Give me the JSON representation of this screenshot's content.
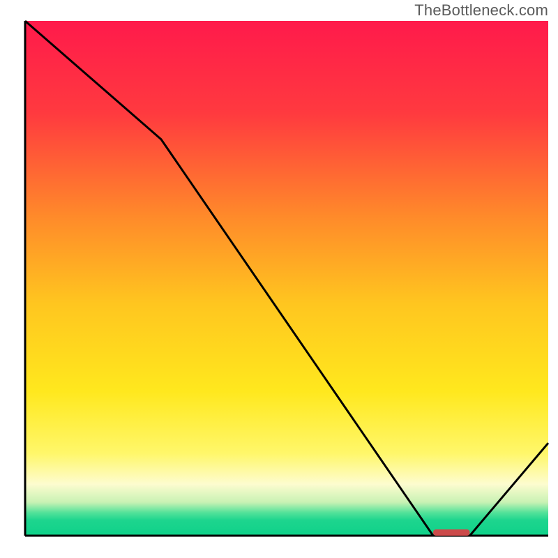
{
  "attribution": "TheBottleneck.com",
  "chart_data": {
    "type": "line",
    "title": "",
    "xlabel": "",
    "ylabel": "",
    "x_range": [
      0,
      100
    ],
    "y_range": [
      0,
      100
    ],
    "curve": {
      "x": [
        0,
        26,
        78,
        85,
        100
      ],
      "y": [
        100,
        77,
        0,
        0,
        18
      ]
    },
    "optimal_band": {
      "x_start": 78,
      "x_end": 85,
      "y": 0
    },
    "gradient_stops": [
      {
        "pos": 0.0,
        "color": "#ff1a4b"
      },
      {
        "pos": 0.18,
        "color": "#ff3a3f"
      },
      {
        "pos": 0.38,
        "color": "#ff8a2a"
      },
      {
        "pos": 0.55,
        "color": "#ffc61f"
      },
      {
        "pos": 0.72,
        "color": "#ffe81e"
      },
      {
        "pos": 0.84,
        "color": "#fff76a"
      },
      {
        "pos": 0.9,
        "color": "#fdfccf"
      },
      {
        "pos": 0.935,
        "color": "#c9f2b4"
      },
      {
        "pos": 0.955,
        "color": "#55e29a"
      },
      {
        "pos": 0.97,
        "color": "#1dd58e"
      },
      {
        "pos": 1.0,
        "color": "#0fd189"
      }
    ],
    "marker_color": "#cc4a4a",
    "curve_color": "#000000",
    "axis_color": "#000000"
  }
}
